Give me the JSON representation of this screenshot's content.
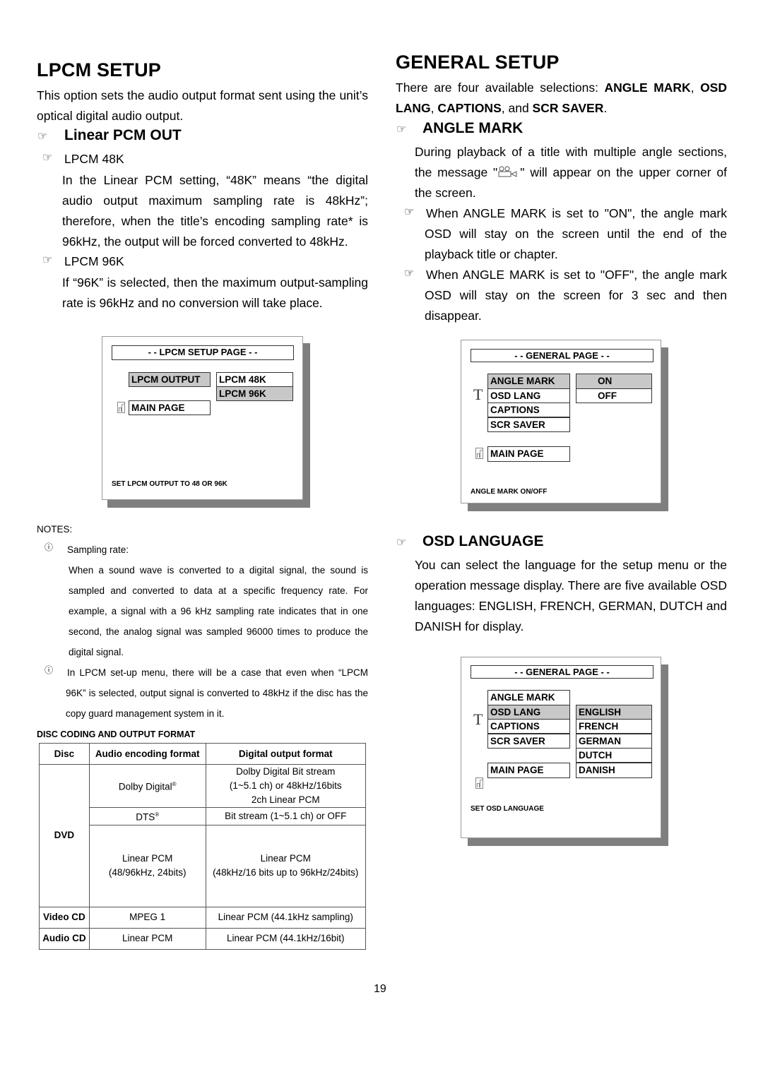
{
  "lpcm": {
    "title": "LPCM SETUP",
    "intro": "This option sets the audio output format sent using the unit’s optical digital audio output.",
    "subheading": "Linear PCM OUT",
    "options": [
      {
        "label": "LPCM 48K",
        "text": "In the Linear PCM setting, “48K” means “the digital audio output maximum sampling rate is 48kHz”; therefore, when the title’s encoding sampling rate* is 96kHz, the output will be forced converted to 48kHz."
      },
      {
        "label": "LPCM 96K",
        "text": "If “96K” is selected, then the maximum output-sampling rate is 96kHz and no conversion will take place."
      }
    ],
    "osd": {
      "title": "- - LPCM SETUP PAGE - -",
      "menu_item": "LPCM OUTPUT",
      "choices": [
        "LPCM 48K",
        "LPCM 96K"
      ],
      "selected_choice": "LPCM 96K",
      "main_page": "MAIN PAGE",
      "status": "SET LPCM OUTPUT TO 48 OR 96K"
    }
  },
  "notes": {
    "heading": "NOTES:",
    "items": [
      {
        "title": "Sampling rate:",
        "text": "When a sound wave is converted to a digital signal, the sound is sampled and converted to data at a specific frequency rate. For example, a signal with a 96 kHz sampling rate indicates that in one second, the analog signal was sampled 96000 times to produce the digital signal."
      },
      {
        "text": "In LPCM set-up menu, there will be a case that even when “LPCM 96K” is selected, output signal is converted to 48kHz if the disc has the copy guard management system in it."
      }
    ]
  },
  "table": {
    "caption": "DISC CODING AND OUTPUT FORMAT",
    "headers": [
      "Disc",
      "Audio encoding format",
      "Digital output format"
    ],
    "rows": [
      {
        "disc": "DVD",
        "encoding": "Dolby Digital",
        "reg": "®",
        "output": [
          "Dolby Digital Bit stream",
          "(1~5.1 ch) or 48kHz/16bits",
          "2ch Linear PCM"
        ]
      },
      {
        "disc": "",
        "encoding": "DTS",
        "reg": "®",
        "output": [
          "Bit stream (1~5.1 ch) or OFF"
        ]
      },
      {
        "disc": "",
        "encoding": "Linear PCM\n(48/96kHz, 24bits)",
        "enc_lines": [
          "Linear PCM",
          "(48/96kHz, 24bits)"
        ],
        "output": [
          "Linear PCM",
          "(48kHz/16 bits up to 96kHz/24bits)"
        ]
      },
      {
        "disc": "Video CD",
        "encoding": "MPEG 1",
        "output": [
          "Linear PCM (44.1kHz sampling)"
        ]
      },
      {
        "disc": "Audio CD",
        "encoding": "Linear PCM",
        "output": [
          "Linear PCM (44.1kHz/16bit)"
        ]
      }
    ]
  },
  "general": {
    "title": "GENERAL SETUP",
    "intro_pre": "There are four available selections: ",
    "selections": [
      "ANGLE MARK",
      "OSD LANG",
      "CAPTIONS",
      "SCR SAVER"
    ],
    "angle": {
      "heading": "ANGLE MARK",
      "text_pre": "During playback of a title with multiple angle sections, the message \"",
      "text_post": "\" will appear on the upper corner of the screen.",
      "icon": "camera-angle-icon",
      "bullets": [
        "When ANGLE MARK is set to \"ON\", the angle mark OSD will stay on the screen until the end of the playback title or chapter.",
        "When ANGLE MARK is set to \"OFF\", the angle mark OSD will stay on the screen for 3 sec and then disappear."
      ],
      "osd": {
        "title": "- - GENERAL PAGE - -",
        "menu": [
          "ANGLE MARK",
          "OSD LANG",
          "CAPTIONS",
          "SCR SAVER"
        ],
        "selected_menu": "ANGLE MARK",
        "choices": [
          "ON",
          "OFF"
        ],
        "selected_choice": "ON",
        "main_page": "MAIN PAGE",
        "status": "ANGLE MARK ON/OFF"
      }
    },
    "osd_lang": {
      "heading": "OSD LANGUAGE",
      "text": "You can select the language for the setup menu or the operation message display. There are five available OSD languages: ENGLISH, FRENCH, GERMAN, DUTCH and DANISH for display.",
      "osd": {
        "title": "- - GENERAL PAGE - -",
        "menu": [
          "ANGLE MARK",
          "OSD LANG",
          "CAPTIONS",
          "SCR SAVER"
        ],
        "selected_menu": "OSD LANG",
        "choices": [
          "ENGLISH",
          "FRENCH",
          "GERMAN",
          "DUTCH",
          "DANISH"
        ],
        "selected_choice": "ENGLISH",
        "main_page": "MAIN PAGE",
        "status": "SET OSD LANGUAGE"
      }
    }
  },
  "page_number": "19"
}
